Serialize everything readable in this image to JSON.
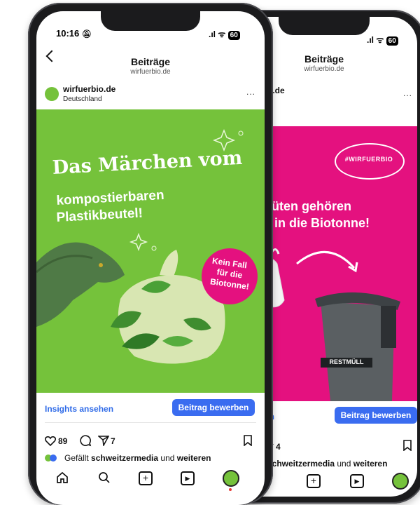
{
  "back_phone": {
    "header_title": "Beiträge",
    "header_sub": "wirfuerbio.de",
    "username_partial": "o.de",
    "location_partial": "d",
    "hashtag": "#WIRFUERBIO",
    "headline_line1": "ktüten gehören",
    "headline_line2": "ls in die Biotonne!",
    "bin_label": "RESTMÜLL",
    "insights_partial": "en",
    "promote_label": "Beitrag bewerben",
    "share_count": "4",
    "likes_text_user": "schweitzermedia",
    "likes_text_mid": " und ",
    "likes_text_end": "weiteren",
    "more_icon": "..."
  },
  "front_phone": {
    "time": "10:16",
    "battery": "60",
    "header_title": "Beiträge",
    "header_sub": "wirfuerbio.de",
    "username": "wirfuerbio.de",
    "location": "Deutschland",
    "more_icon": "...",
    "headline_script": "Das Märchen vom",
    "headline_line2": "kompostierbaren",
    "headline_line3": "Plastikbeutel!",
    "badge_line1": "Kein Fall",
    "badge_line2": "für die",
    "badge_line3": "Biotonne!",
    "insights_label": "Insights ansehen",
    "promote_label": "Beitrag bewerben",
    "like_count": "89",
    "share_count": "7",
    "likes_prefix": "Gefällt ",
    "likes_user": "schweitzermedia",
    "likes_mid": " und ",
    "likes_end": "weiteren"
  },
  "colors": {
    "green": "#75c23b",
    "magenta": "#e4117f",
    "blue_button": "#3a6cf0",
    "insights_blue": "#2f6be8"
  }
}
